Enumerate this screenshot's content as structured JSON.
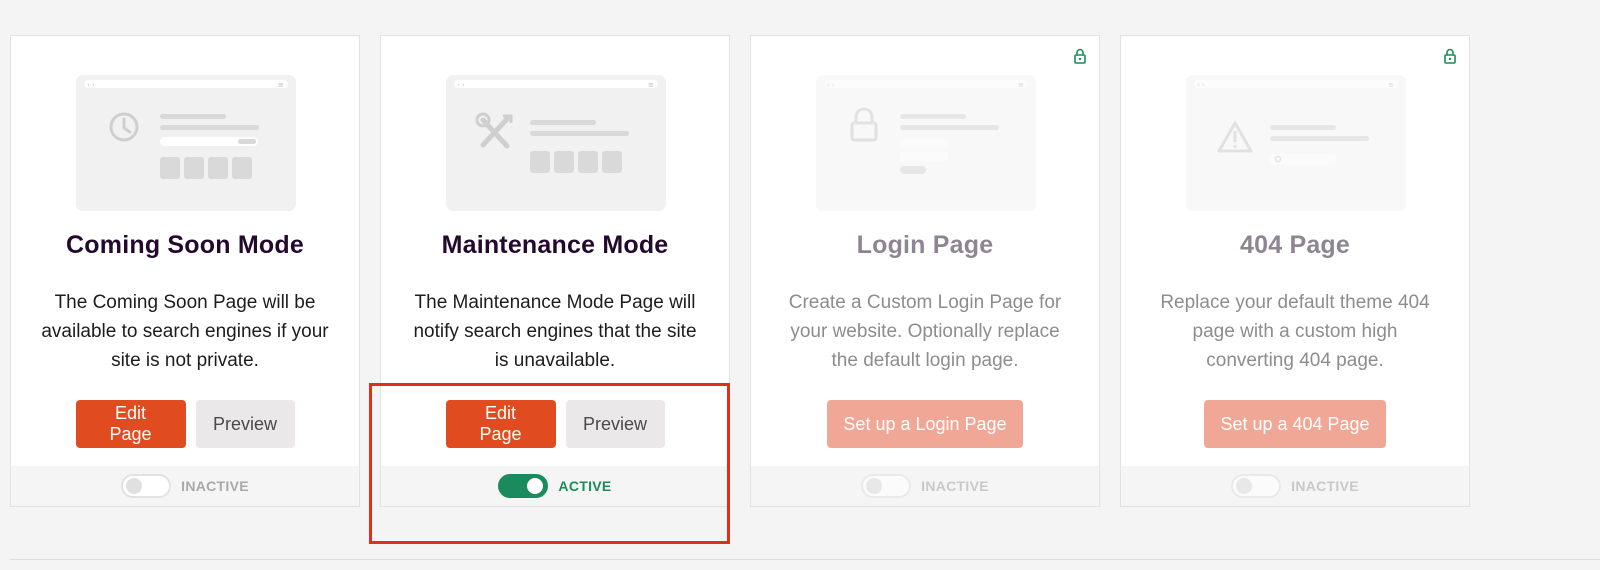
{
  "cards": [
    {
      "title": "Coming Soon Mode",
      "description": "The Coming Soon Page will be available to search engines if your site is not private.",
      "edit_label": "Edit Page",
      "preview_label": "Preview",
      "status": "INACTIVE",
      "active": false,
      "locked": false
    },
    {
      "title": "Maintenance Mode",
      "description": "The Maintenance Mode Page will notify search engines that the site is unavailable.",
      "edit_label": "Edit Page",
      "preview_label": "Preview",
      "status": "ACTIVE",
      "active": true,
      "locked": false
    },
    {
      "title": "Login Page",
      "description": "Create a Custom Login Page for your website. Optionally replace the default login page.",
      "setup_label": "Set up a Login Page",
      "status": "INACTIVE",
      "active": false,
      "locked": true
    },
    {
      "title": "404 Page",
      "description": "Replace your default theme 404 page with a custom high converting 404 page.",
      "setup_label": "Set up a 404 Page",
      "status": "INACTIVE",
      "active": false,
      "locked": true
    }
  ],
  "icons": {
    "lock": "lock-icon",
    "clock": "clock-icon",
    "tools": "tools-icon",
    "padlock": "padlock-icon",
    "warning": "warning-icon"
  },
  "colors": {
    "primary": "#e04c1f",
    "primary_faded": "#f0a796",
    "active_green": "#1a8b5c",
    "highlight": "#e1301a",
    "title": "#23092e"
  }
}
